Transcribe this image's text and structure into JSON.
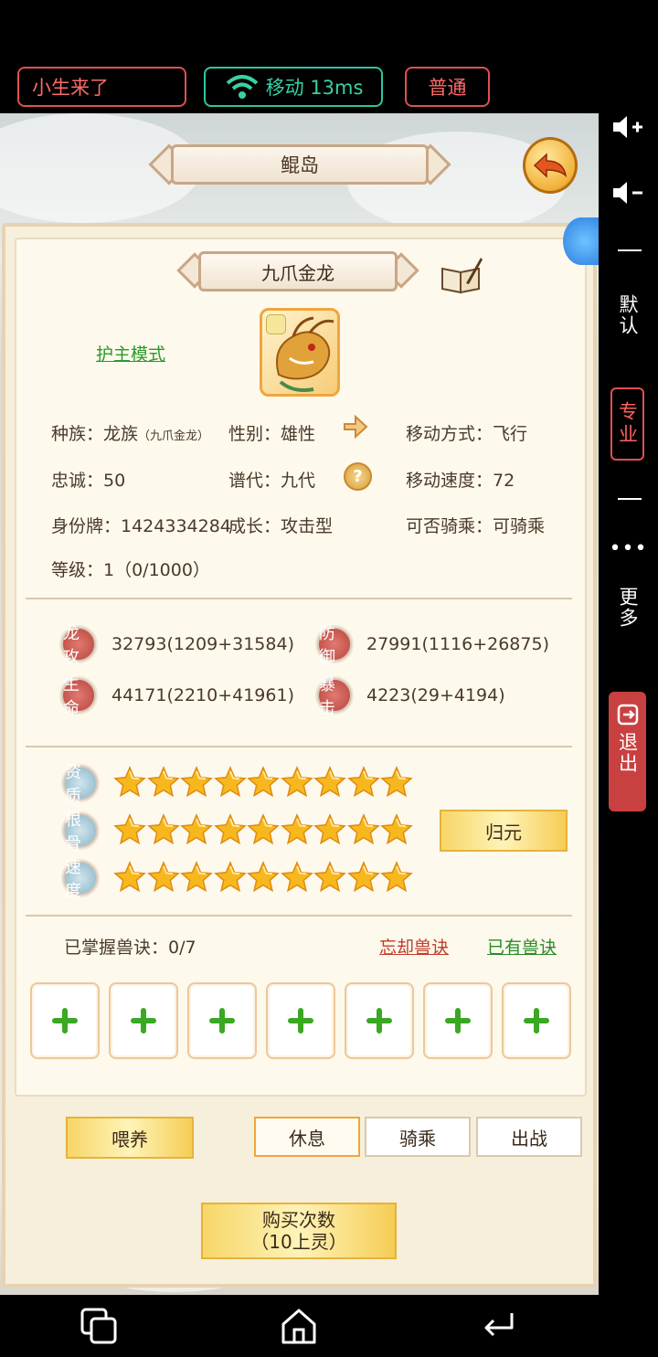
{
  "status_bar": {
    "user": "小生来了",
    "network": "移动 13ms",
    "mode": "普通"
  },
  "scene": {
    "location": "鲲岛"
  },
  "pet": {
    "name": "九爪金龙",
    "guard_mode": "护主模式",
    "info": {
      "race_label": "种族：",
      "race": "龙族",
      "race_sub": "（九爪金龙）",
      "gender": "性别：雄性",
      "move_mode": "移动方式：飞行",
      "loyalty": "忠诚：50",
      "generation": "谱代：九代",
      "move_speed": "移动速度：72",
      "id_tag": "身份牌：1424334284",
      "growth": "成长：攻击型",
      "rideable": "可否骑乘：可骑乘",
      "level": "等级：1（0/1000）"
    },
    "stats": {
      "attack_label": "龙攻",
      "attack": "32793(1209+31584)",
      "defense_label": "防御",
      "defense": "27991(1116+26875)",
      "hp_label": "生命",
      "hp": "44171(2210+41961)",
      "crit_label": "暴击",
      "crit": "4223(29+4194)"
    },
    "quality": {
      "aptitude_label": "资质",
      "aptitude_stars": 9,
      "bone_label": "根骨",
      "bone_stars": 9,
      "speed_label": "速度",
      "speed_stars": 9,
      "reset_button": "归元"
    },
    "skills": {
      "learned": "已掌握兽诀：0/7",
      "forget": "忘却兽诀",
      "owned": "已有兽诀",
      "slot_count": 7
    }
  },
  "actions": {
    "feed": "喂养",
    "rest": "休息",
    "ride": "骑乘",
    "battle": "出战",
    "buy_line1": "购买次数",
    "buy_line2": "（10上灵）"
  },
  "sidebar": {
    "default": "默认",
    "pro": "专业",
    "more": "更多",
    "exit": "退出"
  },
  "colors": {
    "accent_red": "#e05050",
    "accent_green": "#2fc7a0",
    "gold": "#f5cd55"
  }
}
